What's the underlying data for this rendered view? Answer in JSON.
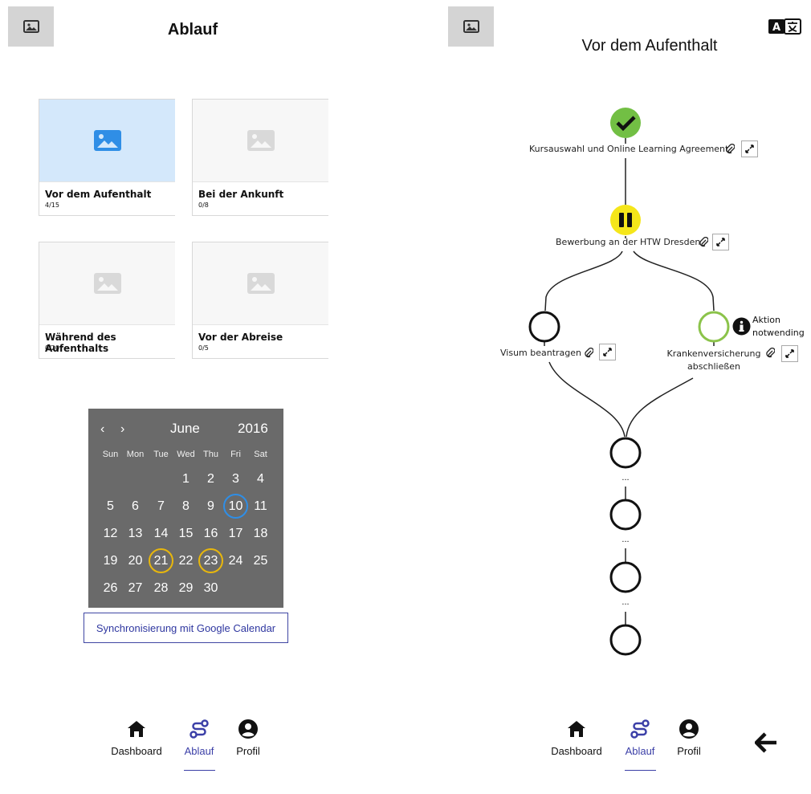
{
  "left": {
    "title": "Ablauf",
    "cards": [
      {
        "title": "Vor dem Aufenthalt",
        "count": "4/15",
        "active": true
      },
      {
        "title": "Bei der Ankunft",
        "count": "0/8",
        "active": false
      },
      {
        "title": "Während des Aufenthalts",
        "count": "0/20",
        "active": false
      },
      {
        "title": "Vor der Abreise",
        "count": "0/5",
        "active": false
      }
    ],
    "calendar": {
      "prev": "‹",
      "next": "›",
      "month": "June",
      "year": "2016",
      "weekdays": [
        "Sun",
        "Mon",
        "Tue",
        "Wed",
        "Thu",
        "Fri",
        "Sat"
      ],
      "days": [
        "1",
        "2",
        "3",
        "4",
        "5",
        "6",
        "7",
        "8",
        "9",
        "10",
        "11",
        "12",
        "13",
        "14",
        "15",
        "16",
        "17",
        "18",
        "19",
        "20",
        "21",
        "22",
        "23",
        "24",
        "25",
        "26",
        "27",
        "28",
        "29",
        "30"
      ],
      "today": "10",
      "events": [
        "21",
        "23"
      ]
    },
    "sync_label": "Synchronisierung mit Google Calendar"
  },
  "nav": {
    "items": [
      {
        "label": "Dashboard",
        "icon": "home-icon"
      },
      {
        "label": "Ablauf",
        "icon": "route-icon"
      },
      {
        "label": "Profil",
        "icon": "user-circle-icon"
      }
    ],
    "active_color": "#3b3fa7"
  },
  "right": {
    "title": "Vor dem Aufenthalt",
    "steps": [
      {
        "label": "Kursauswahl und Online Learning Agreement",
        "status": "done"
      },
      {
        "label": "Bewerbung an der HTW Dresden",
        "status": "paused"
      },
      {
        "label": "Visum beantragen",
        "status": "open"
      },
      {
        "label": "Krankenversicherung abschließen",
        "status": "recommended"
      }
    ],
    "info_text_1": "Aktion",
    "info_text_2": "notwending",
    "ellipsis": "..."
  },
  "colors": {
    "done": "#72bf44",
    "paused": "#f5e61a",
    "recommended": "#8bc34a",
    "calendar_bg": "#6a6a6a",
    "today_ring": "#2f8ee6",
    "event_ring": "#e8b70c"
  }
}
